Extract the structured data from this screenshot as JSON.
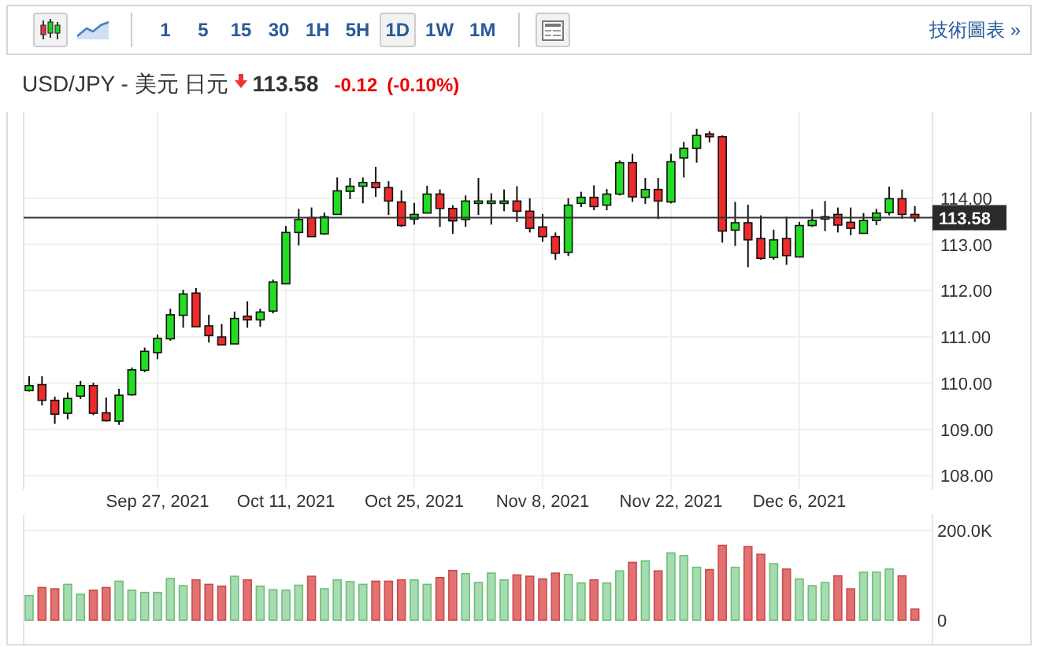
{
  "toolbar": {
    "chart_types": [
      {
        "kind": "candles",
        "selected": true
      },
      {
        "kind": "line",
        "selected": false
      }
    ],
    "intervals": [
      {
        "label": "1",
        "selected": false
      },
      {
        "label": "5",
        "selected": false
      },
      {
        "label": "15",
        "selected": false
      },
      {
        "label": "30",
        "selected": false
      },
      {
        "label": "1H",
        "selected": false
      },
      {
        "label": "5H",
        "selected": false
      },
      {
        "label": "1D",
        "selected": true
      },
      {
        "label": "1W",
        "selected": false
      },
      {
        "label": "1M",
        "selected": false
      }
    ],
    "link": "技術圖表 »"
  },
  "quote": {
    "symbol": "USD/JPY - 美元 日元",
    "falling": true,
    "price": "113.58",
    "change": "-0.12",
    "change_percent": "(-0.10%)"
  },
  "price_chart": {
    "chart_data": {
      "type": "candlestick",
      "categories": [
        null,
        null,
        null,
        null,
        null,
        null,
        null,
        null,
        null,
        null,
        "Sep 27, 2021",
        null,
        null,
        null,
        null,
        null,
        null,
        null,
        null,
        null,
        "Oct 11, 2021",
        null,
        null,
        null,
        null,
        null,
        null,
        null,
        null,
        null,
        "Oct 25, 2021",
        null,
        null,
        null,
        null,
        null,
        null,
        null,
        null,
        null,
        "Nov 8, 2021",
        null,
        null,
        null,
        null,
        null,
        null,
        null,
        null,
        null,
        "Nov 22, 2021",
        null,
        null,
        null,
        null,
        null,
        null,
        null,
        null,
        null,
        "Dec 6, 2021",
        null,
        null,
        null,
        null,
        null,
        null,
        null,
        null,
        null
      ],
      "ohlc": [
        [
          109.84,
          110.15,
          109.82,
          109.95
        ],
        [
          109.97,
          110.15,
          109.52,
          109.63
        ],
        [
          109.63,
          109.71,
          109.12,
          109.33
        ],
        [
          109.35,
          109.8,
          109.22,
          109.67
        ],
        [
          109.72,
          110.05,
          109.66,
          109.95
        ],
        [
          109.95,
          110.01,
          109.31,
          109.35
        ],
        [
          109.36,
          109.69,
          109.17,
          109.19
        ],
        [
          109.18,
          109.88,
          109.1,
          109.74
        ],
        [
          109.75,
          110.34,
          109.73,
          110.29
        ],
        [
          110.28,
          110.77,
          110.24,
          110.69
        ],
        [
          110.66,
          111.05,
          110.52,
          110.97
        ],
        [
          110.96,
          111.61,
          110.92,
          111.48
        ],
        [
          111.47,
          112.02,
          111.2,
          111.93
        ],
        [
          111.95,
          112.06,
          111.22,
          111.22
        ],
        [
          111.24,
          111.48,
          110.88,
          111.03
        ],
        [
          111.0,
          111.28,
          110.83,
          110.83
        ],
        [
          110.85,
          111.55,
          110.85,
          111.4
        ],
        [
          111.45,
          111.77,
          111.2,
          111.37
        ],
        [
          111.37,
          111.61,
          111.22,
          111.54
        ],
        [
          111.56,
          112.24,
          111.51,
          112.19
        ],
        [
          112.15,
          113.4,
          112.15,
          113.26
        ],
        [
          113.26,
          113.77,
          112.98,
          113.54
        ],
        [
          113.58,
          113.8,
          113.17,
          113.17
        ],
        [
          113.23,
          113.69,
          113.21,
          113.6
        ],
        [
          113.65,
          114.45,
          113.65,
          114.16
        ],
        [
          114.15,
          114.44,
          113.98,
          114.26
        ],
        [
          114.26,
          114.45,
          113.89,
          114.34
        ],
        [
          114.34,
          114.68,
          114.03,
          114.23
        ],
        [
          114.23,
          114.37,
          113.64,
          113.94
        ],
        [
          113.92,
          114.17,
          113.38,
          113.41
        ],
        [
          113.55,
          113.9,
          113.43,
          113.65
        ],
        [
          113.68,
          114.27,
          113.68,
          114.09
        ],
        [
          114.09,
          114.19,
          113.38,
          113.78
        ],
        [
          113.78,
          113.85,
          113.23,
          113.51
        ],
        [
          113.54,
          114.06,
          113.38,
          113.94
        ],
        [
          113.94,
          114.44,
          113.64,
          113.94
        ],
        [
          113.94,
          114.11,
          113.43,
          113.94
        ],
        [
          113.94,
          114.19,
          113.72,
          113.94
        ],
        [
          113.94,
          114.26,
          113.49,
          113.72
        ],
        [
          113.72,
          114.0,
          113.26,
          113.35
        ],
        [
          113.38,
          113.66,
          113.06,
          113.17
        ],
        [
          113.17,
          113.26,
          112.67,
          112.81
        ],
        [
          112.83,
          114.0,
          112.75,
          113.85
        ],
        [
          113.89,
          114.14,
          113.81,
          114.02
        ],
        [
          114.02,
          114.28,
          113.74,
          113.82
        ],
        [
          113.85,
          114.2,
          113.74,
          114.09
        ],
        [
          114.09,
          114.82,
          114.06,
          114.77
        ],
        [
          114.77,
          114.96,
          113.92,
          114.03
        ],
        [
          114.02,
          114.44,
          113.88,
          114.19
        ],
        [
          114.19,
          114.44,
          113.55,
          113.94
        ],
        [
          113.92,
          114.96,
          113.89,
          114.79
        ],
        [
          114.87,
          115.22,
          114.45,
          115.08
        ],
        [
          115.08,
          115.5,
          114.77,
          115.36
        ],
        [
          115.39,
          115.45,
          115.21,
          115.33
        ],
        [
          115.33,
          115.36,
          113.04,
          113.29
        ],
        [
          113.31,
          113.92,
          112.97,
          113.47
        ],
        [
          113.47,
          113.86,
          112.51,
          113.1
        ],
        [
          113.13,
          113.63,
          112.67,
          112.7
        ],
        [
          112.72,
          113.32,
          112.67,
          113.1
        ],
        [
          113.13,
          113.6,
          112.56,
          112.76
        ],
        [
          112.73,
          113.49,
          112.73,
          113.41
        ],
        [
          113.41,
          113.76,
          113.38,
          113.52
        ],
        [
          113.55,
          113.94,
          113.29,
          113.6
        ],
        [
          113.65,
          113.8,
          113.26,
          113.42
        ],
        [
          113.48,
          113.8,
          113.2,
          113.35
        ],
        [
          113.24,
          113.68,
          113.24,
          113.52
        ],
        [
          113.52,
          113.77,
          113.42,
          113.68
        ],
        [
          113.69,
          114.25,
          113.63,
          113.99
        ],
        [
          113.99,
          114.19,
          113.56,
          113.65
        ],
        [
          113.65,
          113.83,
          113.49,
          113.58
        ]
      ],
      "ylim": [
        107.7,
        115.87
      ],
      "grid": true,
      "yticks": [
        {
          "value": 108,
          "label": "108.00"
        },
        {
          "value": 109,
          "label": "109.00"
        },
        {
          "value": 110,
          "label": "110.00"
        },
        {
          "value": 111,
          "label": "111.00"
        },
        {
          "value": 112,
          "label": "112.00"
        },
        {
          "value": 113,
          "label": "113.00"
        },
        {
          "value": 114,
          "label": "114.00"
        }
      ]
    },
    "current_label": "113.58"
  },
  "volume_chart": {
    "chart_data": {
      "type": "bar",
      "categories": [
        null,
        null,
        null,
        null,
        null,
        null,
        null,
        null,
        null,
        null,
        null,
        null,
        null,
        null,
        null,
        null,
        null,
        null,
        null,
        null,
        null,
        null,
        null,
        null,
        null,
        null,
        null,
        null,
        null,
        null,
        null,
        null,
        null,
        null,
        null,
        null,
        null,
        null,
        null,
        null,
        null,
        null,
        null,
        null,
        null,
        null,
        null,
        null,
        null,
        null,
        null,
        null,
        null,
        null,
        null,
        null,
        null,
        null,
        null,
        null,
        null,
        null,
        null,
        null,
        null,
        null,
        null,
        null,
        null,
        null
      ],
      "values": [
        55,
        73,
        70,
        80,
        58,
        67,
        73,
        87,
        67,
        62,
        62,
        93,
        77,
        90,
        80,
        76,
        98,
        90,
        76,
        68,
        67,
        78,
        98,
        70,
        90,
        86,
        80,
        87,
        87,
        90,
        90,
        80,
        95,
        111,
        104,
        84,
        105,
        90,
        101,
        98,
        92,
        105,
        102,
        83,
        90,
        83,
        110,
        129,
        132,
        110,
        150,
        144,
        118,
        113,
        167,
        118,
        164,
        147,
        126,
        114,
        92,
        77,
        84,
        99,
        70,
        107,
        107,
        114,
        99,
        25
      ],
      "ylim": [
        0,
        200
      ],
      "yticks": [
        {
          "value": 0,
          "label": "0"
        },
        {
          "value": 200,
          "label": "200.0K"
        }
      ]
    }
  }
}
